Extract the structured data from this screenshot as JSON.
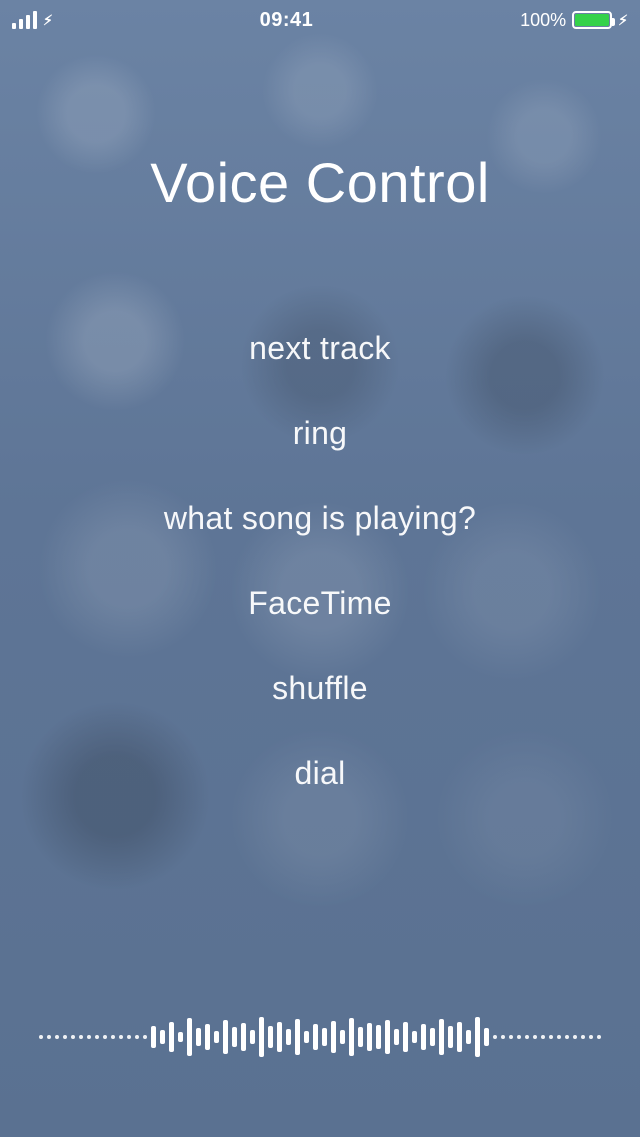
{
  "status": {
    "time": "09:41",
    "battery_percent": "100%"
  },
  "title": "Voice Control",
  "commands": [
    "next track",
    "ring",
    "what song is playing?",
    "FaceTime",
    "shuffle",
    "dial"
  ],
  "waveform_heights": [
    22,
    14,
    30,
    10,
    38,
    18,
    26,
    12,
    34,
    20,
    28,
    14,
    40,
    22,
    30,
    16,
    36,
    12,
    26,
    18,
    32,
    14,
    38,
    20,
    28,
    24,
    34,
    16,
    30,
    12,
    26,
    18,
    36,
    22,
    30,
    14,
    40,
    18
  ],
  "colors": {
    "background_top": "#6b83a4",
    "background_bottom": "#5a7191",
    "battery_fill": "#35d24a",
    "text": "#ffffff"
  }
}
